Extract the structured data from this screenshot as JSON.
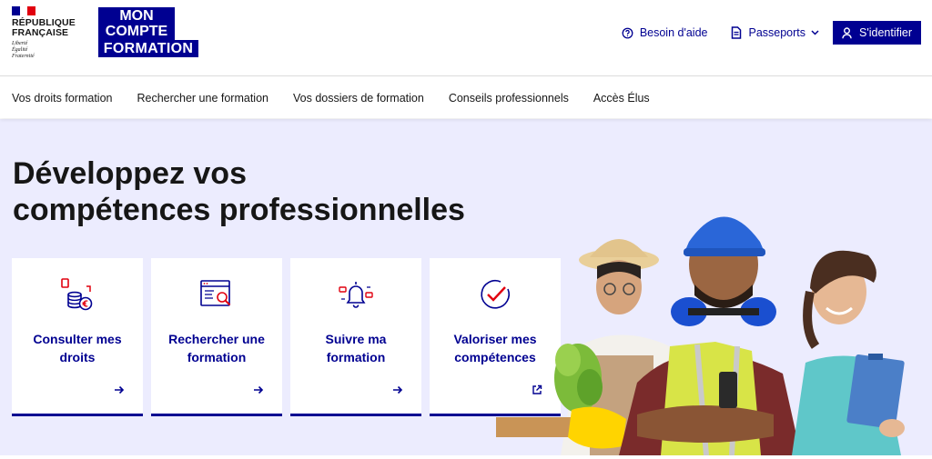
{
  "header": {
    "republic": {
      "name": "RÉPUBLIQUE FRANÇAISE",
      "motto": "Liberté Égalité Fraternité"
    },
    "brand_logo": [
      "MON",
      "COMPTE",
      "FORMATION"
    ],
    "help_label": "Besoin d'aide",
    "passports_label": "Passeports",
    "login_label": "S'identifier"
  },
  "nav": {
    "items": [
      "Vos droits formation",
      "Rechercher une formation",
      "Vos dossiers de formation",
      "Conseils professionnels",
      "Accès Élus"
    ]
  },
  "hero": {
    "title_line1": "Développez vos",
    "title_line2": "compétences professionnelles"
  },
  "cards": [
    {
      "label_line1": "Consulter mes",
      "label_line2": "droits",
      "icon": "coins-icon",
      "arrow": "arrow-right-icon"
    },
    {
      "label_line1": "Rechercher une",
      "label_line2": "formation",
      "icon": "search-document-icon",
      "arrow": "arrow-right-icon"
    },
    {
      "label_line1": "Suivre ma",
      "label_line2": "formation",
      "icon": "bell-notification-icon",
      "arrow": "arrow-right-icon"
    },
    {
      "label_line1": "Valoriser mes",
      "label_line2": "compétences",
      "icon": "check-badge-icon",
      "arrow": "external-link-icon"
    }
  ],
  "colors": {
    "primary": "#000091",
    "accent": "#e1000f",
    "hero_bg": "#ececfe"
  }
}
